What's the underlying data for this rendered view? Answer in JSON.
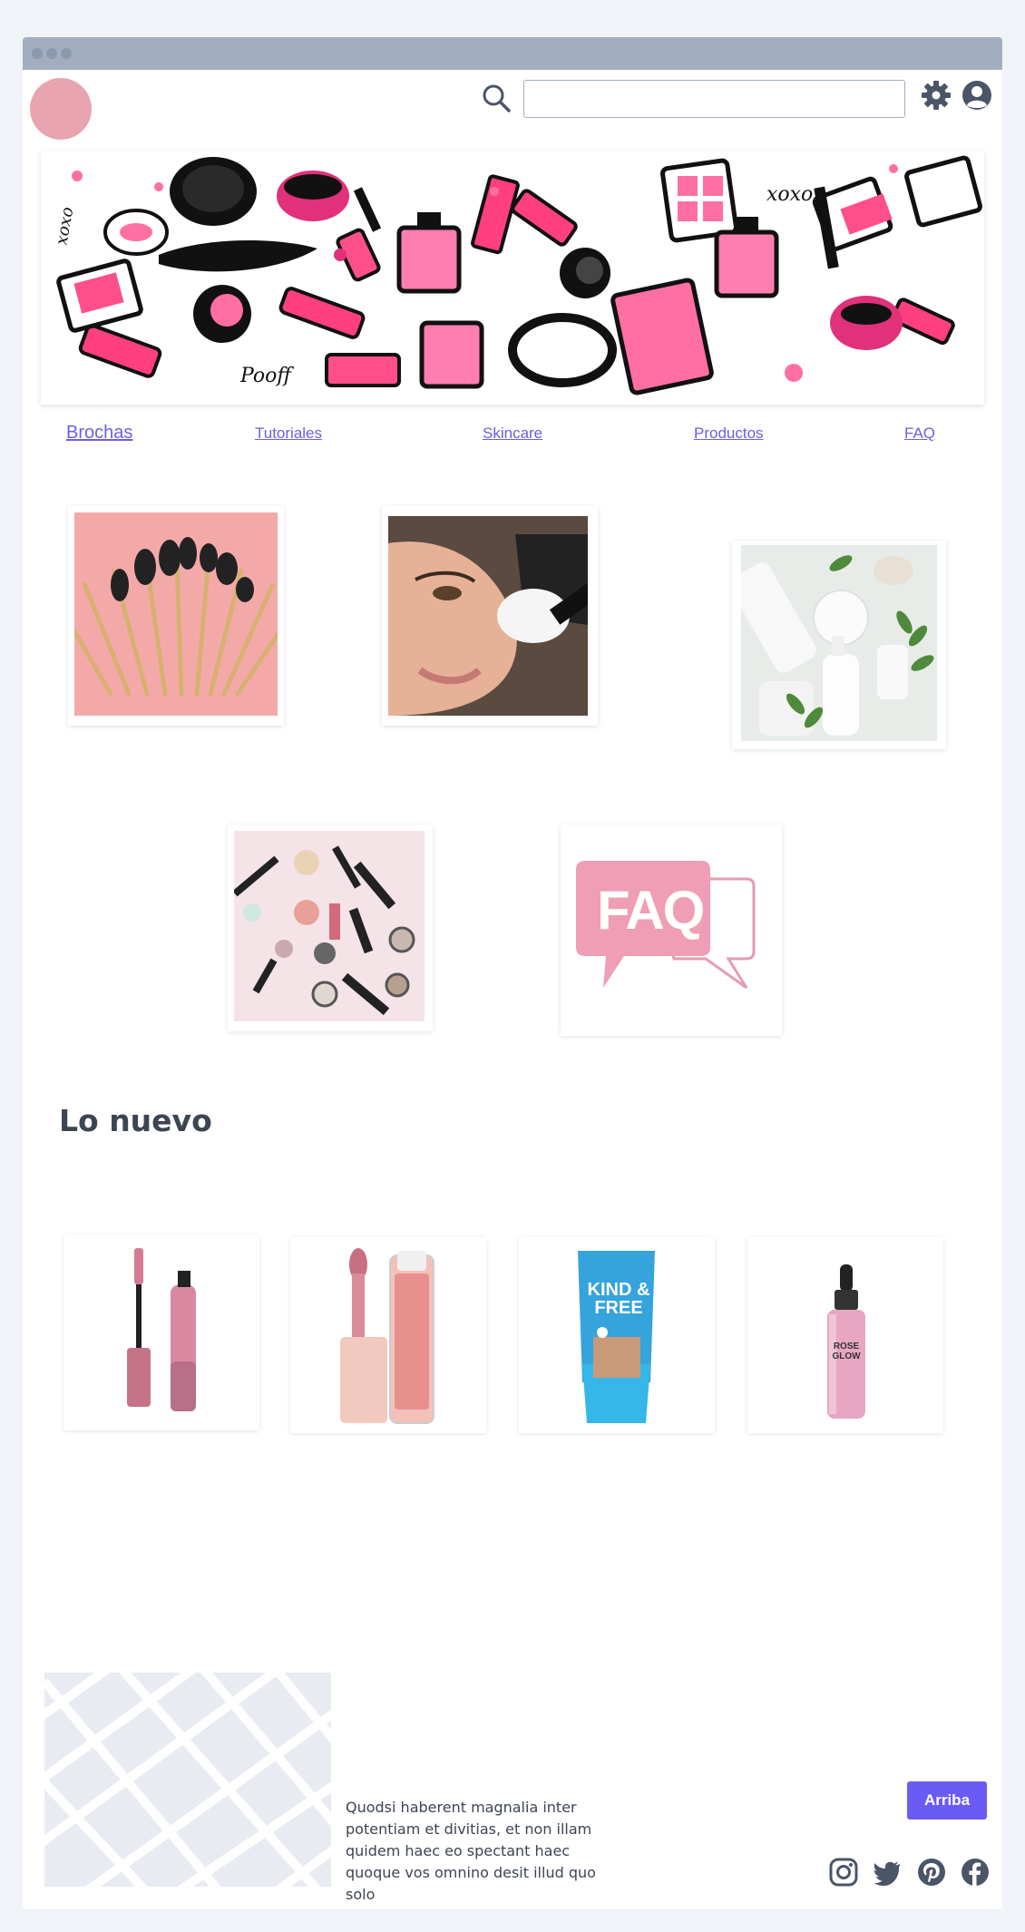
{
  "header": {
    "search_placeholder": "",
    "search_value": ""
  },
  "nav": {
    "items": [
      "Brochas",
      "Tutoriales",
      "Skincare",
      "Productos",
      "FAQ"
    ]
  },
  "categories": [
    {
      "name": "brushes"
    },
    {
      "name": "makeup-application"
    },
    {
      "name": "skincare-products"
    },
    {
      "name": "makeup-flatlay"
    },
    {
      "name": "faq",
      "label": "FAQ"
    }
  ],
  "new_section": {
    "title": "Lo nuevo",
    "products": [
      {
        "name": "mascara",
        "brand_text": ""
      },
      {
        "name": "lip-gloss",
        "brand_text": ""
      },
      {
        "name": "foundation",
        "brand_text": "KIND & FREE"
      },
      {
        "name": "serum",
        "brand_text": "ROSE GLOW"
      }
    ]
  },
  "footer": {
    "text": "Quodsi haberent magnalia inter potentiam et divitias, et non illam quidem haec eo spectant haec quoque vos omnino desit illud quo solo",
    "top_button": "Arriba",
    "social": [
      "instagram-icon",
      "twitter-icon",
      "pinterest-icon",
      "facebook-icon"
    ]
  },
  "colors": {
    "accent": "#6b5bf5",
    "link": "#6b5fe0",
    "brand_pink": "#e8a4b0",
    "titlebar": "#a0aec0"
  }
}
